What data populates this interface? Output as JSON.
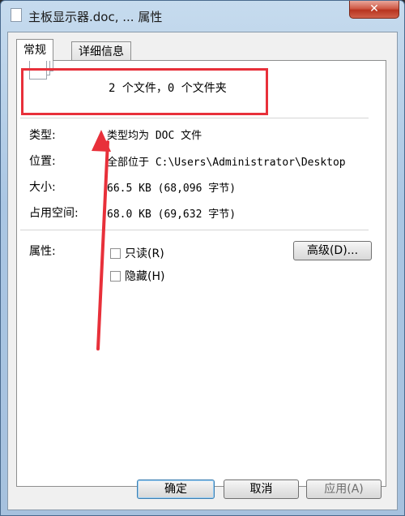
{
  "window": {
    "title": "主板显示器.doc, ... 属性",
    "close_label": "✕"
  },
  "tabs": [
    {
      "label": "常规"
    },
    {
      "label": "详细信息"
    }
  ],
  "summary": "2 个文件，0 个文件夹",
  "properties": {
    "type": {
      "label": "类型:",
      "value": "类型均为 DOC 文件"
    },
    "location": {
      "label": "位置:",
      "value": "全部位于 C:\\Users\\Administrator\\Desktop"
    },
    "size": {
      "label": "大小:",
      "value": "66.5 KB (68,096 字节)"
    },
    "size_on_disk": {
      "label": "占用空间:",
      "value": "68.0 KB (69,632 字节)"
    }
  },
  "attributes": {
    "label": "属性:",
    "readonly_label": "只读(R)",
    "hidden_label": "隐藏(H)",
    "advanced_label": "高级(D)..."
  },
  "buttons": {
    "ok": "确定",
    "cancel": "取消",
    "apply": "应用(A)"
  },
  "colors": {
    "annotation": "#e8303a"
  }
}
